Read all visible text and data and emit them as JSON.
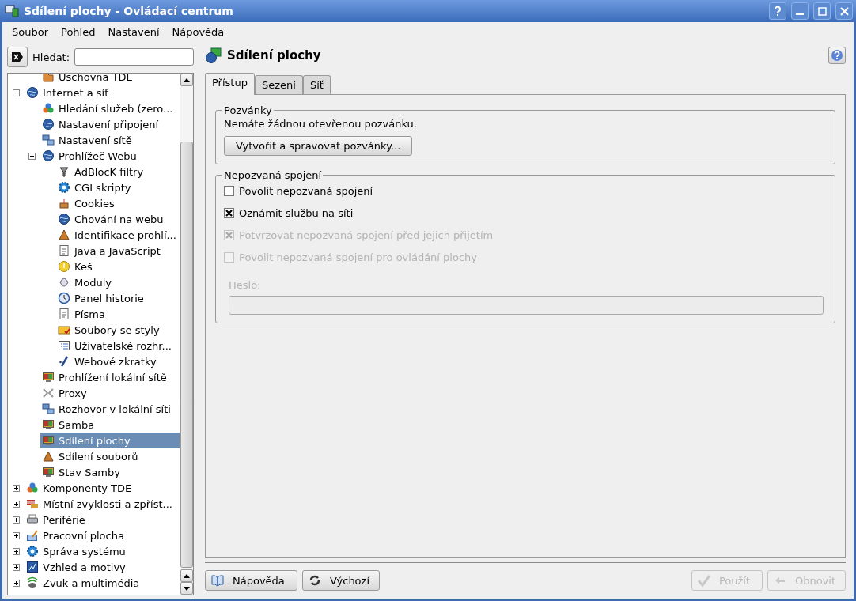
{
  "window": {
    "title": "Sdílení plochy - Ovládací centrum"
  },
  "menu": [
    "Soubor",
    "Pohled",
    "Nastavení",
    "Nápověda"
  ],
  "search": {
    "label": "Hledat:"
  },
  "tree": {
    "scrolled_children": [
      {
        "label": "Uschovna TDE",
        "selected": false
      }
    ],
    "items": [
      {
        "label": "Internet a síť",
        "selected": false,
        "expanded": true,
        "children": [
          {
            "label": "Hledání služeb (zero...",
            "selected": false
          },
          {
            "label": "Nastavení připojení",
            "selected": false
          },
          {
            "label": "Nastavení sítě",
            "selected": false
          },
          {
            "label": "Prohlížeč Webu",
            "selected": false,
            "expanded": true,
            "children": [
              {
                "label": "AdBlocK filtry",
                "selected": false
              },
              {
                "label": "CGI skripty",
                "selected": false
              },
              {
                "label": "Cookies",
                "selected": false
              },
              {
                "label": "Chování na webu",
                "selected": false
              },
              {
                "label": "Identifikace prohlí...",
                "selected": false
              },
              {
                "label": "Java a JavaScript",
                "selected": false
              },
              {
                "label": "Keš",
                "selected": false
              },
              {
                "label": "Moduly",
                "selected": false
              },
              {
                "label": "Panel historie",
                "selected": false
              },
              {
                "label": "Písma",
                "selected": false
              },
              {
                "label": "Soubory se styly",
                "selected": false
              },
              {
                "label": "Uživatelské rozhr...",
                "selected": false
              },
              {
                "label": "Webové zkratky",
                "selected": false
              }
            ]
          },
          {
            "label": "Prohlížení lokální sítě",
            "selected": false
          },
          {
            "label": "Proxy",
            "selected": false
          },
          {
            "label": "Rozhovor v lokální síti",
            "selected": false
          },
          {
            "label": "Samba",
            "selected": false
          },
          {
            "label": "Sdílení plochy",
            "selected": true
          },
          {
            "label": "Sdílení souborů",
            "selected": false
          },
          {
            "label": "Stav Samby",
            "selected": false
          }
        ]
      },
      {
        "label": "Komponenty TDE",
        "selected": false,
        "expanded": false
      },
      {
        "label": "Místní zvyklosti a zpříst...",
        "selected": false,
        "expanded": false
      },
      {
        "label": "Periférie",
        "selected": false,
        "expanded": false
      },
      {
        "label": "Pracovní plocha",
        "selected": false,
        "expanded": false
      },
      {
        "label": "Správa systému",
        "selected": false,
        "expanded": false
      },
      {
        "label": "Vzhled a motivy",
        "selected": false,
        "expanded": false
      },
      {
        "label": "Zvuk a multimédia",
        "selected": false,
        "expanded": false
      }
    ]
  },
  "page": {
    "title": "Sdílení plochy"
  },
  "tabs": [
    {
      "label": "Přístup",
      "selected": true
    },
    {
      "label": "Sezení",
      "selected": false
    },
    {
      "label": "Síť",
      "selected": false
    }
  ],
  "invitations": {
    "title": "Pozvánky",
    "message": "Nemáte žádnou otevřenou pozvánku.",
    "button": "Vytvořit a spravovat pozvánky..."
  },
  "uninvited": {
    "title": "Nepozvaná spojení",
    "options": [
      {
        "label": "Povolit nepozvaná spojení",
        "checked": false,
        "disabled": false
      },
      {
        "label": "Oznámit službu na síti",
        "checked": true,
        "disabled": false
      },
      {
        "label": "Potvrzovat nepozvaná spojení před jejich přijetím",
        "checked": true,
        "disabled": true
      },
      {
        "label": "Povolit nepozvaná spojení pro ovládání plochy",
        "checked": false,
        "disabled": true
      }
    ],
    "password": {
      "label": "Heslo:",
      "disabled": true
    }
  },
  "buttons": [
    {
      "label": "Nápověda",
      "disabled": false
    },
    {
      "label": "Výchozí",
      "disabled": false
    },
    {
      "label": "Použít",
      "disabled": true
    },
    {
      "label": "Obnovit",
      "disabled": true
    }
  ]
}
